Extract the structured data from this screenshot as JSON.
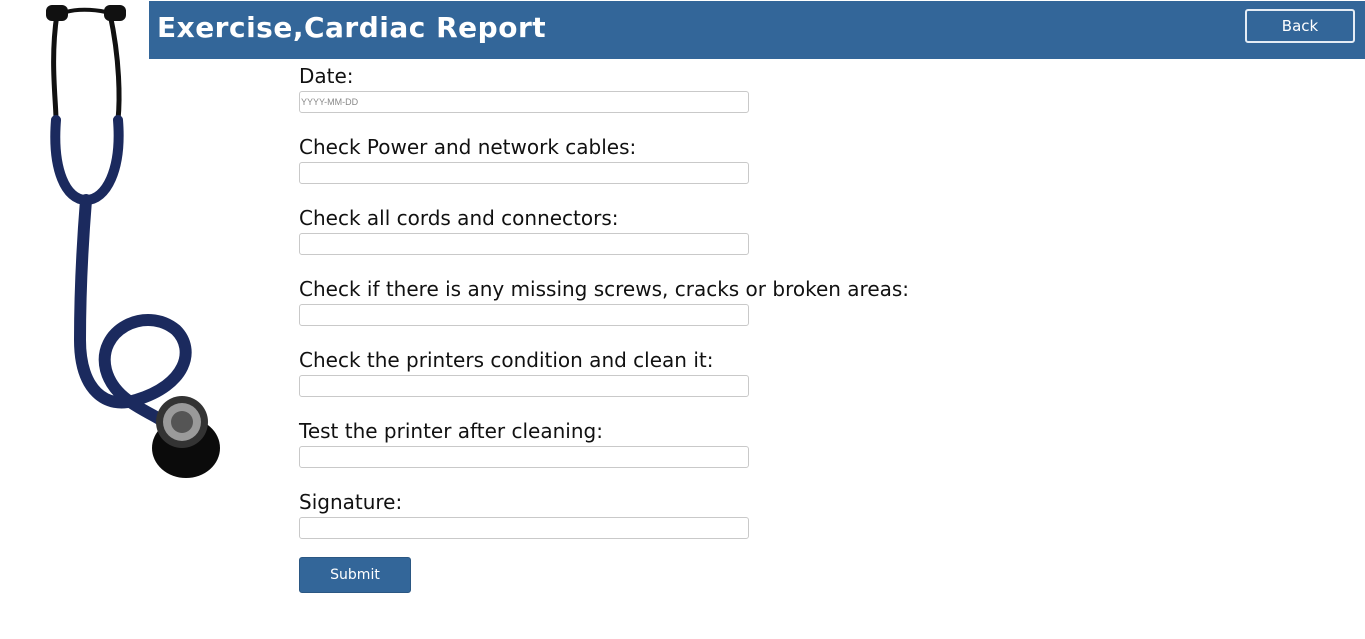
{
  "header": {
    "title": "Exercise,Cardiac Report",
    "back_label": "Back"
  },
  "form": {
    "fields": [
      {
        "label": "Date:",
        "value": "",
        "placeholder": "YYYY-MM-DD"
      },
      {
        "label": "Check Power and network cables:",
        "value": "",
        "placeholder": ""
      },
      {
        "label": "Check all cords and connectors:",
        "value": "",
        "placeholder": ""
      },
      {
        "label": "Check if there is any missing screws, cracks or broken areas:",
        "value": "",
        "placeholder": ""
      },
      {
        "label": "Check the printers condition and clean it:",
        "value": "",
        "placeholder": ""
      },
      {
        "label": "Test the printer after cleaning:",
        "value": "",
        "placeholder": ""
      },
      {
        "label": "Signature:",
        "value": "",
        "placeholder": ""
      }
    ],
    "submit_label": "Submit"
  },
  "image": {
    "icon": "stethoscope-icon"
  },
  "colors": {
    "brand": "#336699",
    "background": "#ffffff"
  }
}
